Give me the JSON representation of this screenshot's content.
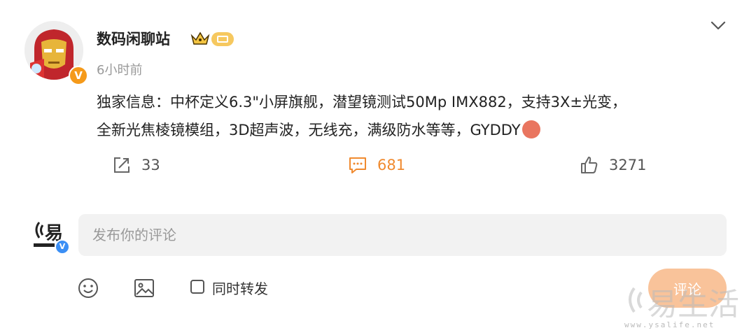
{
  "post": {
    "username": "数码闲聊站",
    "time": "6小时前",
    "verified_badge": "V",
    "content_line1": "独家信息：中杯定义6.3\"小屏旗舰，潜望镜测试50Mp IMX882，支持3X±光变，",
    "content_line2": "全新光焦棱镜模组，3D超声波，无线充，满级防水等等，GYDDY",
    "actions": {
      "repost_count": "33",
      "comment_count": "681",
      "like_count": "3271"
    }
  },
  "comment_box": {
    "placeholder": "发布你的评论",
    "verified_badge": "V",
    "repost_label": "同时转发",
    "submit_label": "评论"
  },
  "colors": {
    "accent": "#f08a2f",
    "submit_bg": "#f9c39a",
    "input_bg": "#f2f2f2",
    "muted": "#999999"
  },
  "watermark": {
    "text": "易生活",
    "url": "www.ysalife.net"
  }
}
